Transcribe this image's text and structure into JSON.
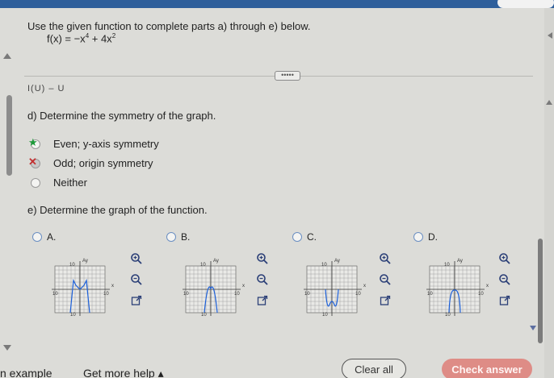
{
  "instruction": "Use the given function to complete parts a) through e) below.",
  "function": {
    "lhs": "f(x) = −x",
    "exp1": "4",
    "mid": " + 4x",
    "exp2": "2"
  },
  "more_button": "•••••",
  "cutoff_text": "I(U) – U",
  "part_d": {
    "question": "d) Determine the symmetry of the graph.",
    "options": [
      {
        "label": "Even; y-axis symmetry",
        "status": "correct"
      },
      {
        "label": "Odd; origin symmetry",
        "status": "incorrect"
      },
      {
        "label": "Neither",
        "status": "none"
      }
    ]
  },
  "part_e": {
    "question": "e) Determine the graph of the function.",
    "choices": [
      {
        "letter": "A."
      },
      {
        "letter": "B."
      },
      {
        "letter": "C."
      },
      {
        "letter": "D."
      }
    ],
    "graph_labels": {
      "ymax": "10",
      "ymin": "10",
      "xmin": "10",
      "xmax": "10",
      "xaxis": "x",
      "yaxis": "Ay"
    }
  },
  "footer": {
    "example": "n example",
    "get_help": "Get more help ▴",
    "clear_all": "Clear all",
    "check_answer": "Check answer"
  },
  "colors": {
    "topbar": "#2e5f9b",
    "check_button": "#de8c86",
    "correct": "#1e9a3a",
    "incorrect": "#c43030",
    "tool_icon": "#2b3f77"
  }
}
